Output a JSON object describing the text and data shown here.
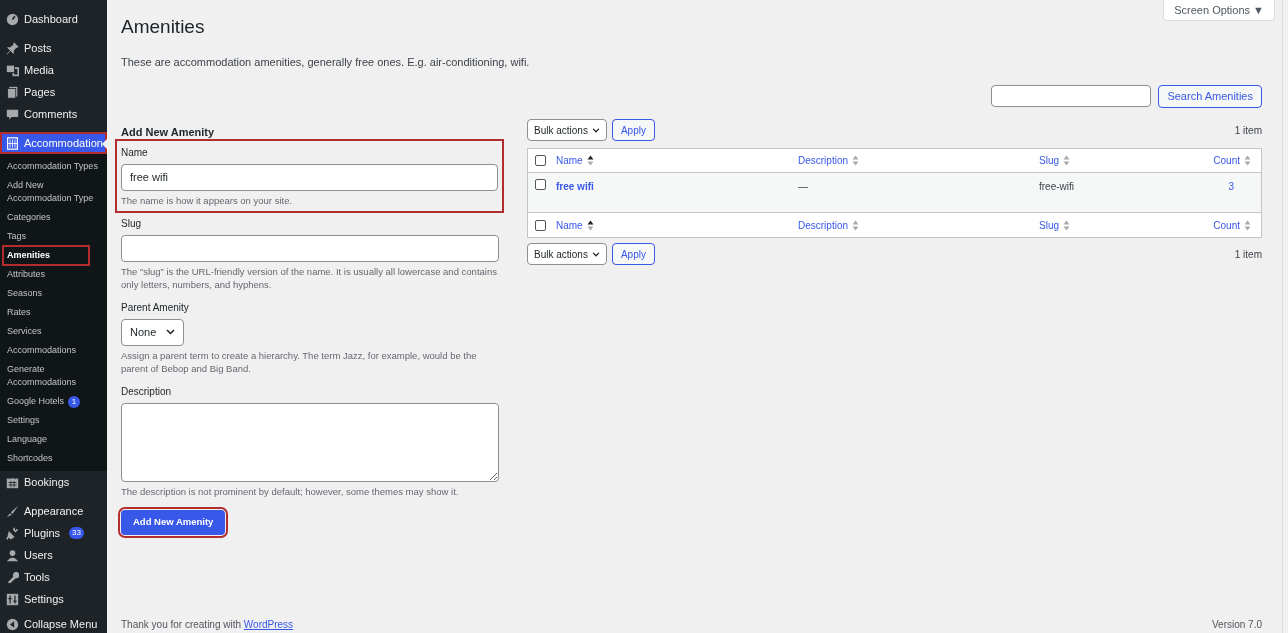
{
  "sidebar": {
    "groups": [
      [
        {
          "label": "Dashboard",
          "kind": "gauge",
          "selected": false,
          "highlighted": false
        }
      ],
      [
        {
          "label": "Posts",
          "kind": "pin",
          "selected": false,
          "highlighted": false
        },
        {
          "label": "Media",
          "kind": "media",
          "selected": false,
          "highlighted": false
        },
        {
          "label": "Pages",
          "kind": "pages",
          "selected": false,
          "highlighted": false
        },
        {
          "label": "Comments",
          "kind": "bubble",
          "selected": false,
          "highlighted": false
        }
      ],
      [
        {
          "label": "Accommodation",
          "kind": "building",
          "selected": true,
          "highlighted": true,
          "children": [
            {
              "label": "Accommodation Types",
              "selected": false,
              "highlighted": false
            },
            {
              "label": "Add New Accommodation Type",
              "selected": false,
              "highlighted": false
            },
            {
              "label": "Categories",
              "selected": false,
              "highlighted": false
            },
            {
              "label": "Tags",
              "selected": false,
              "highlighted": false
            },
            {
              "label": "Amenities",
              "selected": true,
              "highlighted": true
            },
            {
              "label": "Attributes",
              "selected": false,
              "highlighted": false
            },
            {
              "label": "Seasons",
              "selected": false,
              "highlighted": false
            },
            {
              "label": "Rates",
              "selected": false,
              "highlighted": false
            },
            {
              "label": "Services",
              "selected": false,
              "highlighted": false
            },
            {
              "label": "Accommodations",
              "selected": false,
              "highlighted": false
            },
            {
              "label": "Generate Accommodations",
              "selected": false,
              "highlighted": false
            },
            {
              "label": "Google Hotels",
              "badge": "1",
              "selected": false,
              "highlighted": false
            },
            {
              "label": "Settings",
              "selected": false,
              "highlighted": false
            },
            {
              "label": "Language",
              "selected": false,
              "highlighted": false
            },
            {
              "label": "Shortcodes",
              "selected": false,
              "highlighted": false
            }
          ]
        },
        {
          "label": "Bookings",
          "kind": "calendar",
          "selected": false,
          "highlighted": false
        }
      ],
      [
        {
          "label": "Appearance",
          "kind": "brush",
          "selected": false,
          "highlighted": false
        },
        {
          "label": "Plugins",
          "kind": "plug",
          "badge": "33",
          "selected": false,
          "highlighted": false
        },
        {
          "label": "Users",
          "kind": "user",
          "selected": false,
          "highlighted": false
        },
        {
          "label": "Tools",
          "kind": "wrench",
          "selected": false,
          "highlighted": false
        },
        {
          "label": "Settings",
          "kind": "sliders",
          "selected": false,
          "highlighted": false
        }
      ]
    ],
    "collapse": "Collapse Menu"
  },
  "screen_options": "Screen Options ▼",
  "title": "Amenities",
  "intro": "These are accommodation amenities, generally free ones. E.g. air-conditioning, wifi.",
  "search": {
    "button": "Search Amenities"
  },
  "form": {
    "heading": "Add New Amenity",
    "fields": [
      {
        "kind": "text",
        "label": "Name",
        "value": "free wifi",
        "hint": "The name is how it appears on your site.",
        "highlighted": true
      },
      {
        "kind": "text",
        "label": "Slug",
        "hint": "The “slug” is the URL-friendly version of the name. It is usually all lowercase and contains only letters, numbers, and hyphens."
      },
      {
        "kind": "select",
        "label": "Parent Amenity",
        "value": "None",
        "hint": "Assign a parent term to create a hierarchy. The term Jazz, for example, would be the parent of Bebop and Big Band."
      },
      {
        "kind": "textarea",
        "label": "Description",
        "hint": "The description is not prominent by default; however, some themes may show it."
      }
    ],
    "submit": {
      "label": "Add New Amenity",
      "highlighted": true
    }
  },
  "table": {
    "top_nav": {
      "bulk_actions": "Bulk actions",
      "apply": "Apply",
      "count": "1 item"
    },
    "bottom_nav": {
      "bulk_actions": "Bulk actions",
      "apply": "Apply",
      "count": "1 item"
    },
    "columns": [
      {
        "label": "Name",
        "sorted": true
      },
      {
        "label": "Description",
        "sorted": false
      },
      {
        "label": "Slug",
        "sorted": false
      },
      {
        "label": "Count",
        "sorted": false
      }
    ],
    "footer_columns": [
      {
        "label": "Name",
        "sorted": true
      },
      {
        "label": "Description",
        "sorted": false
      },
      {
        "label": "Slug",
        "sorted": false
      },
      {
        "label": "Count",
        "sorted": false
      }
    ],
    "rows": [
      {
        "checked": false,
        "name": "free wifi",
        "description": "—",
        "slug": "free-wifi",
        "count": "3"
      }
    ],
    "header_checked": false,
    "footer_checked": false
  },
  "footer": {
    "thanks": "Thank you for creating with ",
    "link": "WordPress",
    "version": "Version 7.0"
  }
}
